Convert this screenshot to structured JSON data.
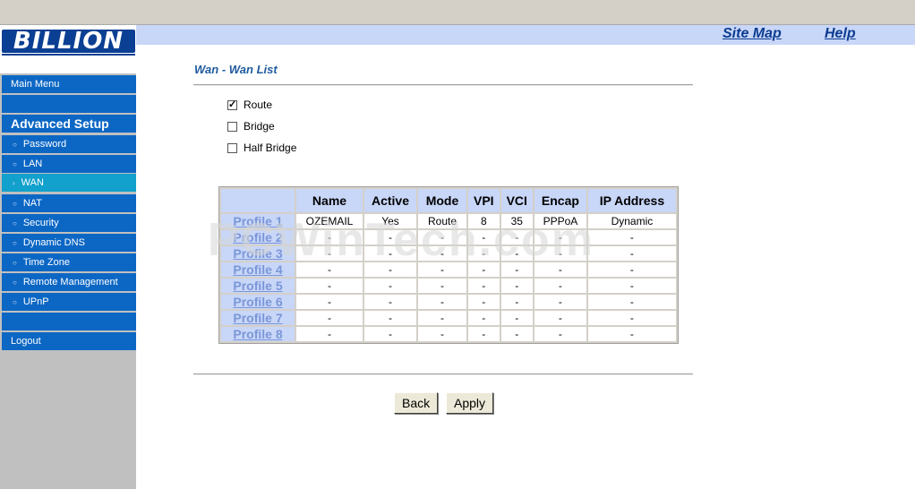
{
  "logo": {
    "text": "BILLION"
  },
  "header": {
    "site_map": "Site Map",
    "help": "Help"
  },
  "sidebar": {
    "main_menu": "Main Menu",
    "advanced_setup": "Advanced Setup",
    "items": [
      "Password",
      "LAN",
      "WAN",
      "NAT",
      "Security",
      "Dynamic DNS",
      "Time Zone",
      "Remote Management",
      "UPnP"
    ],
    "logout": "Logout",
    "active_item": "WAN"
  },
  "page": {
    "title": "Wan - Wan List",
    "options": [
      {
        "label": "Route",
        "checked": true
      },
      {
        "label": "Bridge",
        "checked": false
      },
      {
        "label": "Half Bridge",
        "checked": false
      }
    ]
  },
  "table": {
    "headers": [
      "Name",
      "Active",
      "Mode",
      "VPI",
      "VCI",
      "Encap",
      "IP Address"
    ],
    "rows": [
      {
        "profile": "Profile 1",
        "cells": [
          "OZEMAIL",
          "Yes",
          "Route",
          "8",
          "35",
          "PPPoA",
          "Dynamic"
        ]
      },
      {
        "profile": "Profile 2",
        "cells": [
          "-",
          "-",
          "-",
          "-",
          "-",
          "-",
          "-"
        ]
      },
      {
        "profile": "Profile 3",
        "cells": [
          "-",
          "-",
          "-",
          "-",
          "-",
          "-",
          "-"
        ]
      },
      {
        "profile": "Profile 4",
        "cells": [
          "-",
          "-",
          "-",
          "-",
          "-",
          "-",
          "-"
        ]
      },
      {
        "profile": "Profile 5",
        "cells": [
          "-",
          "-",
          "-",
          "-",
          "-",
          "-",
          "-"
        ]
      },
      {
        "profile": "Profile 6",
        "cells": [
          "-",
          "-",
          "-",
          "-",
          "-",
          "-",
          "-"
        ]
      },
      {
        "profile": "Profile 7",
        "cells": [
          "-",
          "-",
          "-",
          "-",
          "-",
          "-",
          "-"
        ]
      },
      {
        "profile": "Profile 8",
        "cells": [
          "-",
          "-",
          "-",
          "-",
          "-",
          "-",
          "-"
        ]
      }
    ]
  },
  "watermark": "PCWinTech.com",
  "buttons": {
    "back": "Back",
    "apply": "Apply"
  },
  "colors": {
    "sidebar_blue": "#0c67c4",
    "active_item": "#12a0cc",
    "header_band": "#c8d6f8",
    "title_blue": "#1f5b9e"
  }
}
